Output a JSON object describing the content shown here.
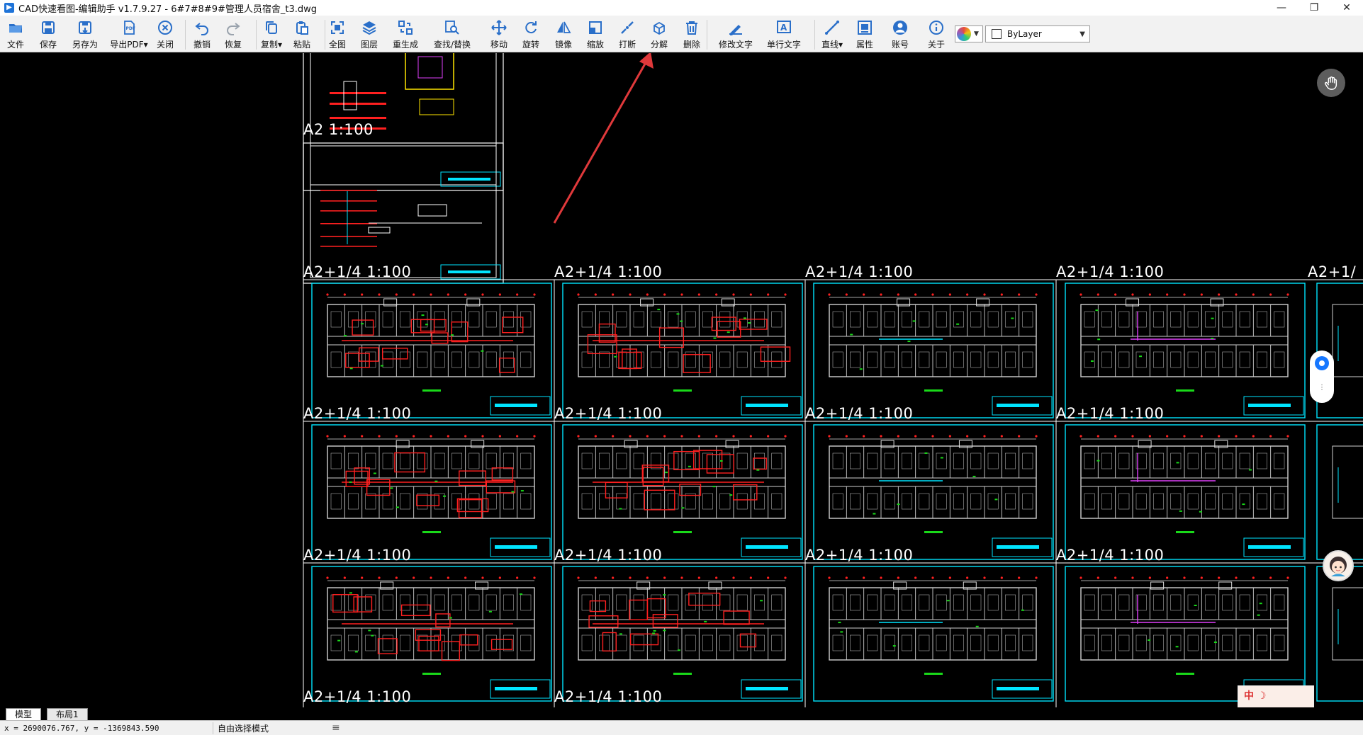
{
  "window": {
    "title": "CAD快速看图-编辑助手 v1.7.9.27 - 6#7#8#9#管理人员宿舍_t3.dwg",
    "minimize": "—",
    "restore": "❐",
    "close": "✕"
  },
  "toolbar": {
    "items": [
      {
        "label": "文件",
        "icon": "folder-icon"
      },
      {
        "label": "保存",
        "icon": "save-icon"
      },
      {
        "label": "另存为",
        "icon": "save-as-icon"
      },
      {
        "label": "导出PDF▾",
        "icon": "pdf-icon"
      },
      {
        "label": "关闭",
        "icon": "close-circle-icon"
      },
      {
        "label": "撤销",
        "icon": "undo-icon"
      },
      {
        "label": "恢复",
        "icon": "redo-icon"
      },
      {
        "label": "复制▾",
        "icon": "copy-icon"
      },
      {
        "label": "粘贴",
        "icon": "paste-icon"
      },
      {
        "label": "全图",
        "icon": "fit-view-icon"
      },
      {
        "label": "图层",
        "icon": "layers-icon"
      },
      {
        "label": "重生成",
        "icon": "regen-icon"
      },
      {
        "label": "查找/替换",
        "icon": "find-replace-icon"
      },
      {
        "label": "移动",
        "icon": "move-icon"
      },
      {
        "label": "旋转",
        "icon": "rotate-icon"
      },
      {
        "label": "镜像",
        "icon": "mirror-icon"
      },
      {
        "label": "缩放",
        "icon": "scale-icon"
      },
      {
        "label": "打断",
        "icon": "break-icon"
      },
      {
        "label": "分解",
        "icon": "explode-icon"
      },
      {
        "label": "删除",
        "icon": "trash-icon"
      },
      {
        "label": "修改文字",
        "icon": "edit-text-icon"
      },
      {
        "label": "单行文字",
        "icon": "single-text-icon"
      },
      {
        "label": "直线▾",
        "icon": "line-icon"
      },
      {
        "label": "属性",
        "icon": "properties-icon"
      },
      {
        "label": "账号",
        "icon": "account-icon"
      },
      {
        "label": "关于",
        "icon": "info-icon"
      }
    ],
    "layer_value": "ByLayer",
    "colors": {
      "icon": "#2a6fc9",
      "accent": "#1e73d8"
    }
  },
  "drawing": {
    "sheet_labels": [
      "A2 1:100",
      "A2+1/4 1:100",
      "A2+1/4 1:100",
      "A2+1/4 1:100",
      "A2+1/4 1:100",
      "A2+1/",
      "A2+1/4 1:100",
      "A2+1/4 1:100",
      "A2+1/4 1:100",
      "A2+1/4 1:100",
      "A2+1/4 1:100",
      "A2+1/4 1:100",
      "A2+1/4 1:100",
      "A2+1/4 1:100",
      "A2+1/4 1:100",
      "A2+1/4 1:100"
    ],
    "colors": {
      "frame": "#00e5ff",
      "wall": "#d0d0d0",
      "red": "#ff2020",
      "green": "#19d919",
      "magenta": "#e040fb",
      "yellow": "#ffe600"
    }
  },
  "ime": {
    "text": "中 ☽"
  },
  "layout_tabs": [
    "模型",
    "布局1"
  ],
  "status": {
    "coords": "x = 2690076.767, y = -1369843.590",
    "mode": "自由选择模式",
    "menu_icon": "≡"
  }
}
